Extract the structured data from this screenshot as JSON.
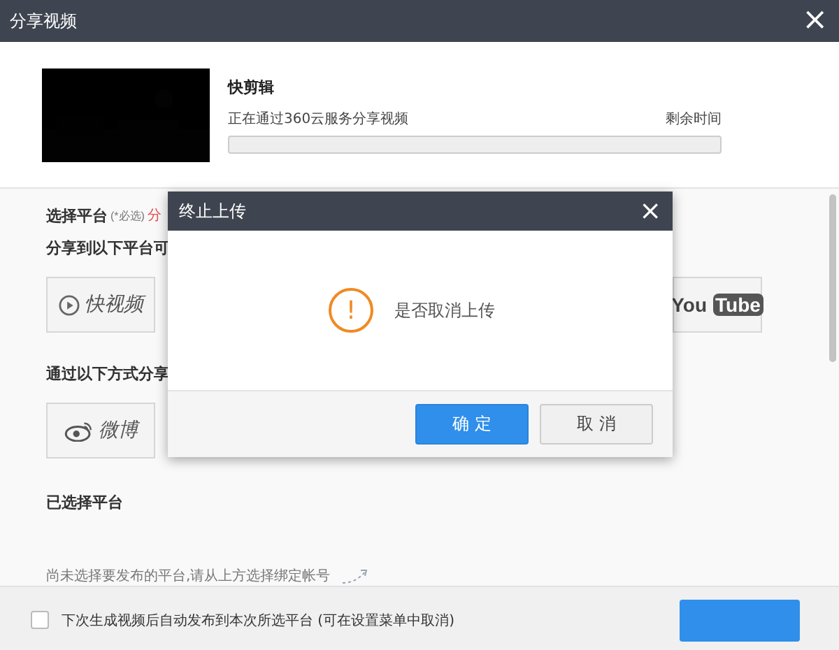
{
  "window": {
    "title": "分享视频",
    "close": "×"
  },
  "video": {
    "name": "快剪辑",
    "status": "正在通过360云服务分享视频",
    "remaining_label": "剩余时间",
    "progress": {
      "level": 0
    }
  },
  "platform_section": {
    "title": "选择平台",
    "required": "(*必选)",
    "note": "分",
    "share_title": "分享到以下平台可",
    "platforms": [
      {
        "kind": "kuaishipin",
        "label": "快视频"
      },
      {
        "kind": "youtube",
        "label": "You",
        "label2": "Tube"
      }
    ],
    "other_title": "通过以下方式分享",
    "others": [
      {
        "kind": "weibo",
        "label": "微博"
      }
    ],
    "selected_title": "已选择平台",
    "empty_hint": "尚未选择要发布的平台,请从上方选择绑定帐号"
  },
  "footer": {
    "auto_publish": {
      "label": "下次生成视频后自动发布到本次所选平台 (可在设置菜单中取消)",
      "checked": false
    }
  },
  "dialog": {
    "title": "终止上传",
    "close": "×",
    "message": "是否取消上传",
    "icon": "!",
    "buttons": [
      {
        "label": "确 定",
        "kind": "primary"
      },
      {
        "label": "取 消",
        "kind": "secondary"
      }
    ]
  }
}
